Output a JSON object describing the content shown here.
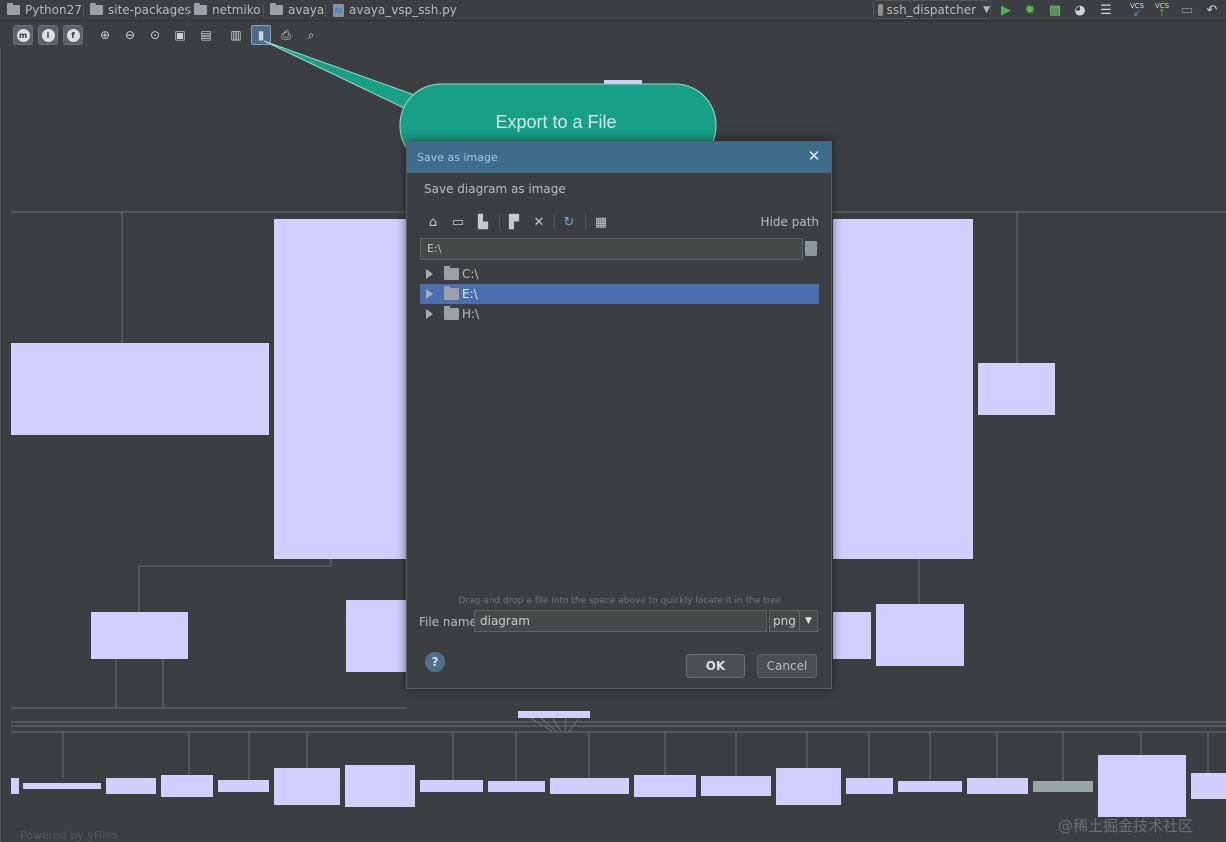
{
  "breadcrumb": {
    "items": [
      {
        "label": "Python27",
        "icon": "folder-icon"
      },
      {
        "label": "site-packages",
        "icon": "folder-icon"
      },
      {
        "label": "netmiko",
        "icon": "folder-icon"
      },
      {
        "label": "avaya",
        "icon": "folder-icon"
      },
      {
        "label": "avaya_vsp_ssh.py",
        "icon": "python-file-icon"
      }
    ]
  },
  "run_toolbar": {
    "config_label": "ssh_dispatcher",
    "vcs_label": "VCS",
    "buttons": [
      "run-icon",
      "debug-icon",
      "coverage-icon",
      "profile-icon",
      "build-icon",
      "vcs-update-icon",
      "vcs-commit-icon",
      "history-icon",
      "undo-icon"
    ]
  },
  "diagram_toolbar": {
    "buttons": [
      "m-icon",
      "i-icon",
      "f-icon",
      "zoom-in-icon",
      "zoom-out-icon",
      "actual-size-icon",
      "fit-content-icon",
      "apply-layout-icon",
      "save-icon",
      "export-icon",
      "print-icon",
      "print-preview-icon"
    ],
    "active": "export-icon"
  },
  "callout": {
    "text": "Export to a File",
    "color": "#17a085"
  },
  "dialog": {
    "title": "Save as image",
    "subtitle": "Save diagram as image",
    "hide_path_label": "Hide path",
    "path_value": "E:\\",
    "toolbar": [
      "home-icon",
      "desktop-icon",
      "project-folder-icon",
      "new-folder-icon",
      "delete-icon",
      "refresh-icon",
      "show-hidden-icon"
    ],
    "tree": [
      {
        "label": "C:\\",
        "selected": false
      },
      {
        "label": "E:\\",
        "selected": true
      },
      {
        "label": "H:\\",
        "selected": false
      }
    ],
    "drag_hint": "Drag and drop a file into the space above to quickly locate it in the tree",
    "file_name_label": "File name:",
    "file_name_value": "diagram",
    "format_value": "png",
    "ok_label": "OK",
    "cancel_label": "Cancel",
    "accent": "#4b6eaf"
  },
  "footer": {
    "powered_by": "Powered by yFiles"
  },
  "watermark": "@稀土掘金技术社区",
  "colors": {
    "background": "#3b3f42",
    "node_fill": "#d0cfff",
    "title_bar": "#3e6d8b"
  }
}
